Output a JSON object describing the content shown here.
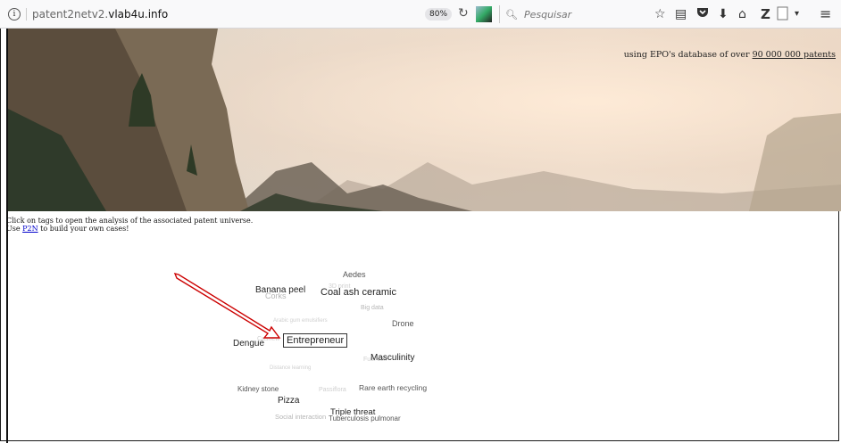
{
  "browser": {
    "url_prefix": "patent2netv2.",
    "url_domain": "vlab4u.info",
    "zoom": "80%",
    "search_placeholder": "Pesquisar",
    "icons": [
      "info-icon",
      "reload-icon",
      "search-icon",
      "star-icon",
      "reading-list-icon",
      "pocket-icon",
      "download-icon",
      "home-icon",
      "zotero-icon",
      "menu-icon"
    ]
  },
  "hero": {
    "subtitle_prefix": "using EPO's database of over ",
    "subtitle_link": "90 000 000 patents"
  },
  "intro": {
    "line1": "Click on tags to open the analysis of the associated patent universe.",
    "line2_prefix": "Use ",
    "line2_link": "P2N",
    "line2_suffix": " to build your own cases!"
  },
  "tags": {
    "aedes": "Aedes",
    "banana_peel": "Banana peel",
    "corks": "Corks",
    "three_d_print": "3D print",
    "coal_ash_ceramic": "Coal ash ceramic",
    "big_data": "Big data",
    "arabic_gum": "Arabic gum emulsifiers",
    "drone": "Drone",
    "dengue": "Dengue",
    "cashew": "Cashew",
    "entrepreneur": "Entrepreneur",
    "fuel_cell": "Fuel cell",
    "masculinity": "Masculinity",
    "distance_learning": "Distance learning",
    "kidney_stone": "Kidney stone",
    "passiflora": "Passiflora",
    "rare_earth": "Rare earth recycling",
    "pizza": "Pizza",
    "triple_threat": "Triple threat",
    "social_interaction": "Social interaction",
    "tuberculosis": "Tuberculosis pulmonar"
  },
  "colors": {
    "arrow": "#cc0000",
    "link": "#0000cc"
  }
}
